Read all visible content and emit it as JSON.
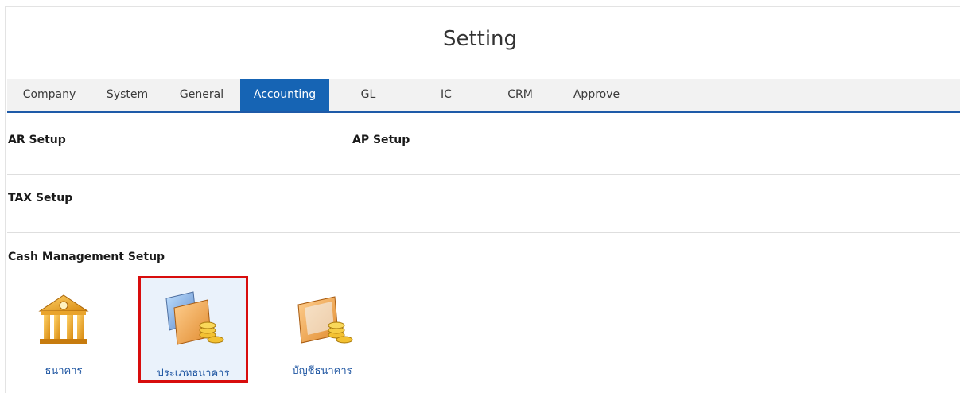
{
  "page": {
    "title": "Setting"
  },
  "tabs": [
    {
      "label": "Company"
    },
    {
      "label": "System"
    },
    {
      "label": "General"
    },
    {
      "label": "Accounting"
    },
    {
      "label": "GL"
    },
    {
      "label": "IC"
    },
    {
      "label": "CRM"
    },
    {
      "label": "Approve"
    }
  ],
  "active_tab": "Accounting",
  "sections": {
    "ar_setup": "AR Setup",
    "ap_setup": "AP Setup",
    "tax_setup": "TAX Setup",
    "cash_setup": "Cash Management Setup"
  },
  "cash_items": [
    {
      "label": "ธนาคาร",
      "icon": "bank-building-icon"
    },
    {
      "label": "ประเภทธนาคาร",
      "icon": "bank-type-folder-icon"
    },
    {
      "label": "บัญชีธนาคาร",
      "icon": "bank-account-folder-icon"
    }
  ],
  "colors": {
    "accent": "#1664b4",
    "highlight_border": "#d80d0d",
    "link": "#1f56a2"
  }
}
